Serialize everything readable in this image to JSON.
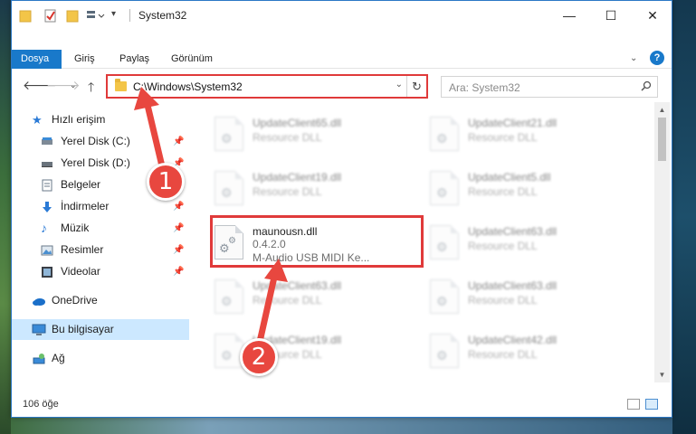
{
  "window": {
    "title": "System32",
    "minimize": "—",
    "maximize": "☐",
    "close": "✕"
  },
  "ribbon": {
    "tabs": [
      "Dosya",
      "Giriş",
      "Paylaş",
      "Görünüm"
    ],
    "expand": "⌄",
    "help": "?"
  },
  "address_bar": {
    "path": "C:\\Windows\\System32",
    "search_placeholder": "Ara: System32"
  },
  "nav_pane": {
    "items": [
      {
        "label": "Hızlı erişim",
        "icon": "star-icon",
        "pinned": false
      },
      {
        "label": "Yerel Disk (C:)",
        "icon": "drive-icon",
        "pinned": true
      },
      {
        "label": "Yerel Disk (D:)",
        "icon": "drive-icon",
        "pinned": true
      },
      {
        "label": "Belgeler",
        "icon": "documents-icon",
        "pinned": true
      },
      {
        "label": "İndirmeler",
        "icon": "downloads-icon",
        "pinned": true
      },
      {
        "label": "Müzik",
        "icon": "music-icon",
        "pinned": true
      },
      {
        "label": "Resimler",
        "icon": "pictures-icon",
        "pinned": true
      },
      {
        "label": "Videolar",
        "icon": "videos-icon",
        "pinned": true
      },
      {
        "label": "OneDrive",
        "icon": "cloud-icon",
        "pinned": false
      },
      {
        "label": "Bu bilgisayar",
        "icon": "computer-icon",
        "pinned": false,
        "selected": true
      },
      {
        "label": "Ağ",
        "icon": "network-icon",
        "pinned": false
      }
    ]
  },
  "files": [
    {
      "name": "UpdateClient65.dll",
      "line2": "Resource DLL",
      "blurred": true
    },
    {
      "name": "UpdateClient21.dll",
      "line2": "Resource DLL",
      "blurred": true
    },
    {
      "name": "UpdateClient19.dll",
      "line2": "Resource DLL",
      "blurred": true
    },
    {
      "name": "UpdateClient5.dll",
      "line2": "Resource DLL",
      "blurred": true
    },
    {
      "name": "maunousn.dll",
      "line2": "0.4.2.0",
      "line3": "M-Audio USB MIDI Ke...",
      "blurred": false,
      "highlighted": true
    },
    {
      "name": "UpdateClient63.dll",
      "line2": "Resource DLL",
      "blurred": true
    },
    {
      "name": "UpdateClient63.dll",
      "line2": "Resource DLL",
      "blurred": true
    },
    {
      "name": "UpdateClient63.dll",
      "line2": "Resource DLL",
      "blurred": true
    },
    {
      "name": "UpdateClient19.dll",
      "line2": "Resource DLL",
      "blurred": true
    },
    {
      "name": "UpdateClient42.dll",
      "line2": "Resource DLL",
      "blurred": true
    }
  ],
  "status_bar": {
    "item_count": "106 öğe"
  },
  "annotations": {
    "step1": "1",
    "step2": "2",
    "highlight_color": "#e03a3a"
  },
  "colors": {
    "accent": "#1979ca",
    "selection": "#cce8ff",
    "callout": "#e8473f"
  }
}
